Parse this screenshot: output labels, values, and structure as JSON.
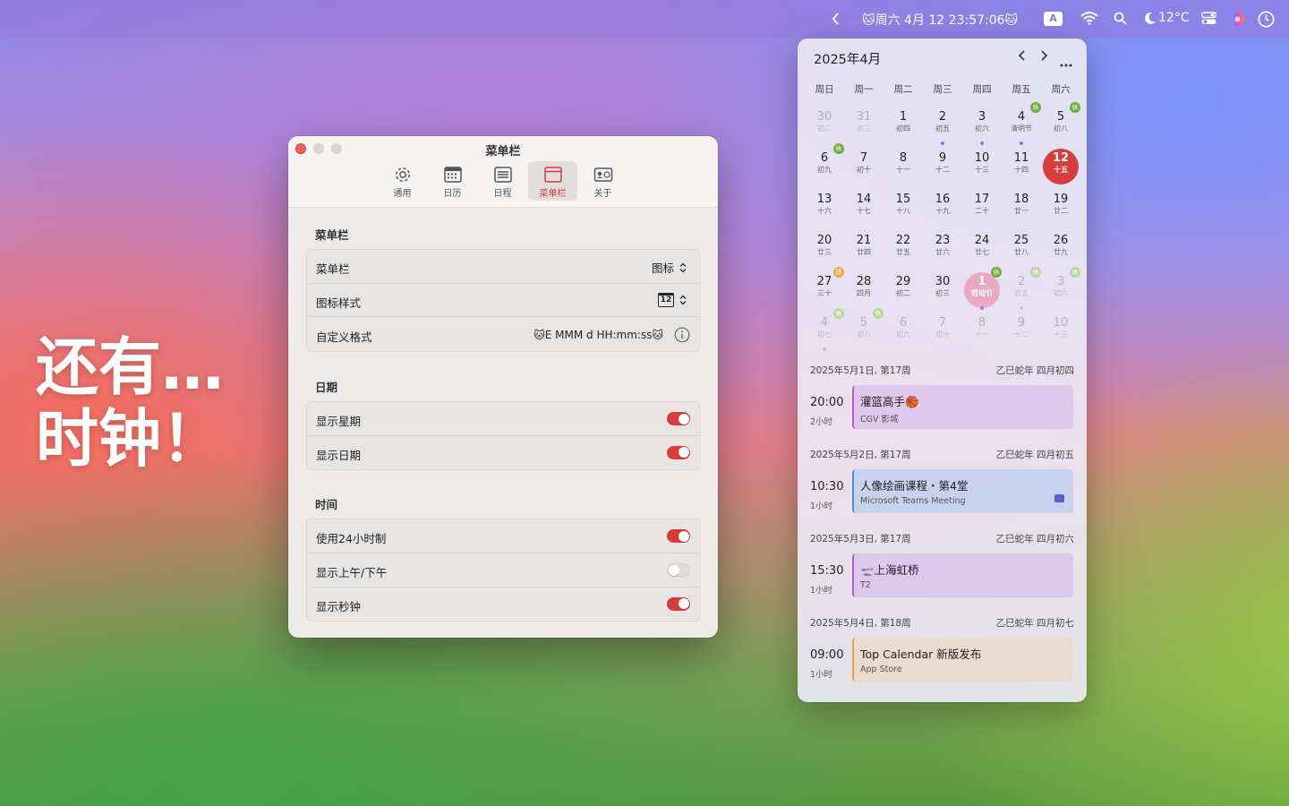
{
  "menubar": {
    "clock": "🐱周六 4月 12 23:57:06🐱",
    "input_method": "A",
    "weather": "12°C"
  },
  "hero": {
    "line1": "还有…",
    "line2": "时钟！"
  },
  "settings": {
    "title": "菜单栏",
    "tabs": [
      {
        "label": "通用"
      },
      {
        "label": "日历"
      },
      {
        "label": "日程"
      },
      {
        "label": "菜单栏"
      },
      {
        "label": "关于"
      }
    ],
    "sections": [
      {
        "title": "菜单栏",
        "rows": [
          {
            "label": "菜单栏",
            "value": "图标"
          },
          {
            "label": "图标样式",
            "value": "12"
          },
          {
            "label": "自定义格式",
            "value": "🐱E MMM d HH:mm:ss🐱"
          }
        ]
      },
      {
        "title": "日期",
        "rows": [
          {
            "label": "显示星期",
            "on": true
          },
          {
            "label": "显示日期",
            "on": true
          }
        ]
      },
      {
        "title": "时间",
        "rows": [
          {
            "label": "使用24小时制",
            "on": true
          },
          {
            "label": "显示上午/下午",
            "on": false
          },
          {
            "label": "显示秒钟",
            "on": true
          }
        ]
      }
    ]
  },
  "calendar": {
    "month_title": "2025年4月",
    "weekdays": [
      "周日",
      "周一",
      "周二",
      "周三",
      "周四",
      "周五",
      "周六"
    ],
    "weeks": [
      [
        {
          "n": "30",
          "l": "初二",
          "dim": true
        },
        {
          "n": "31",
          "l": "初三",
          "dim": true
        },
        {
          "n": "1",
          "l": "初四",
          "dot": ""
        },
        {
          "n": "2",
          "l": "初五",
          "dot": "#b167d9"
        },
        {
          "n": "3",
          "l": "初六",
          "dot": "#b167d9"
        },
        {
          "n": "4",
          "l": "清明节",
          "badge": "休",
          "dot": "#4a9be0"
        },
        {
          "n": "5",
          "l": "初八",
          "badge": "休"
        }
      ],
      [
        {
          "n": "6",
          "l": "初九",
          "badge": "休"
        },
        {
          "n": "7",
          "l": "初十"
        },
        {
          "n": "8",
          "l": "十一"
        },
        {
          "n": "9",
          "l": "十二"
        },
        {
          "n": "10",
          "l": "十三"
        },
        {
          "n": "11",
          "l": "十四"
        },
        {
          "n": "12",
          "l": "十五",
          "today": true
        }
      ],
      [
        {
          "n": "13",
          "l": "十六"
        },
        {
          "n": "14",
          "l": "十七"
        },
        {
          "n": "15",
          "l": "十八"
        },
        {
          "n": "16",
          "l": "十九"
        },
        {
          "n": "17",
          "l": "二十"
        },
        {
          "n": "18",
          "l": "廿一"
        },
        {
          "n": "19",
          "l": "廿二"
        }
      ],
      [
        {
          "n": "20",
          "l": "廿三"
        },
        {
          "n": "21",
          "l": "廿四"
        },
        {
          "n": "22",
          "l": "廿五"
        },
        {
          "n": "23",
          "l": "廿六"
        },
        {
          "n": "24",
          "l": "廿七"
        },
        {
          "n": "25",
          "l": "廿八"
        },
        {
          "n": "26",
          "l": "廿九"
        }
      ],
      [
        {
          "n": "27",
          "l": "三十",
          "badge": "班"
        },
        {
          "n": "28",
          "l": "四月"
        },
        {
          "n": "29",
          "l": "初二"
        },
        {
          "n": "30",
          "l": "初三"
        },
        {
          "n": "1",
          "l": "劳动节",
          "badge": "休",
          "holiday": true,
          "dot": "#b167d9"
        },
        {
          "n": "2",
          "l": "初五",
          "dim": true,
          "badge": "休",
          "dot": "#b7c7e8"
        },
        {
          "n": "3",
          "l": "初六",
          "dim": true,
          "badge": "休"
        }
      ],
      [
        {
          "n": "4",
          "l": "初七",
          "dim": true,
          "badge": "休",
          "dot": "#f0a8a8"
        },
        {
          "n": "5",
          "l": "初八",
          "dim": true,
          "badge": "休"
        },
        {
          "n": "6",
          "l": "初九",
          "dim": true
        },
        {
          "n": "7",
          "l": "初十",
          "dim": true
        },
        {
          "n": "8",
          "l": "十一",
          "dim": true
        },
        {
          "n": "9",
          "l": "十二",
          "dim": true
        },
        {
          "n": "10",
          "l": "十三",
          "dim": true
        }
      ]
    ],
    "agenda": [
      {
        "date": "2025年5月1日, 第17周",
        "lunar": "乙巳蛇年 四月初四",
        "time": "20:00",
        "duration": "2小时",
        "title": "灌篮高手🏀",
        "subtitle": "CGV 影城",
        "color": "#b25fd6",
        "bg": "rgba(214,178,236,.55)"
      },
      {
        "date": "2025年5月2日, 第17周",
        "lunar": "乙巳蛇年 四月初五",
        "time": "10:30",
        "duration": "1小时",
        "title": "人像绘画课程・第4堂",
        "subtitle": "Microsoft Teams Meeting",
        "color": "#4d8ee0",
        "bg": "rgba(178,198,240,.6)"
      },
      {
        "date": "2025年5月3日, 第17周",
        "lunar": "乙巳蛇年 四月初六",
        "time": "15:30",
        "duration": "1小时",
        "title": "🛫上海虹桥",
        "subtitle": "T2",
        "color": "#b25fd6",
        "bg": "rgba(214,178,236,.55)"
      },
      {
        "date": "2025年5月4日, 第18周",
        "lunar": "乙巳蛇年 四月初七",
        "time": "09:00",
        "duration": "1小时",
        "title": "Top Calendar 新版发布",
        "subtitle": "App Store",
        "color": "#e7a242",
        "bg": "rgba(240,214,190,.65)"
      }
    ]
  }
}
